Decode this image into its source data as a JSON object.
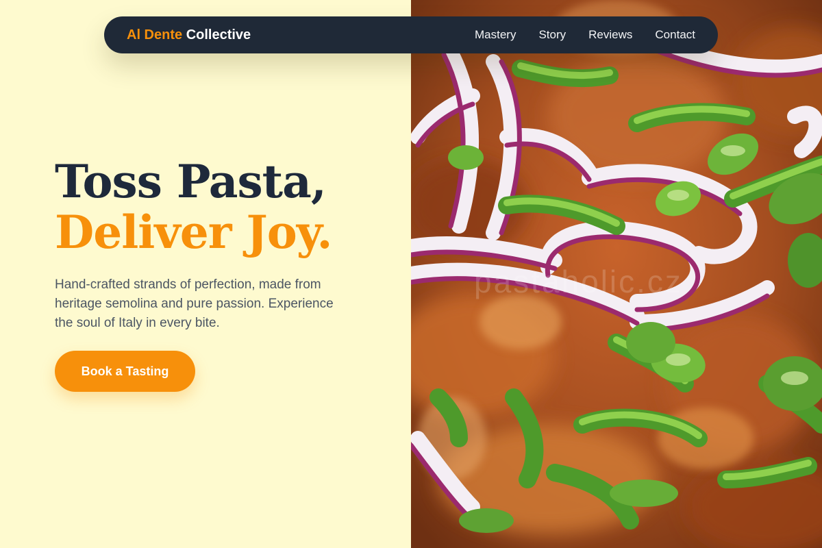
{
  "nav": {
    "brand_accent": "Al Dente",
    "brand_main": "Collective",
    "links": [
      "Mastery",
      "Story",
      "Reviews",
      "Contact"
    ]
  },
  "hero": {
    "headline_line1": "Toss Pasta,",
    "headline_line2": "Deliver Joy.",
    "subtext": "Hand-crafted strands of perfection, made from heritage semolina and pure passion. Experience the soul of Italy in every bite.",
    "cta_label": "Book a Tasting"
  },
  "photo": {
    "subject": "close-up of pasta topped with sliced red onion and green onion",
    "watermark": "pastaholic.cz"
  },
  "colors": {
    "background": "#fefacf",
    "accent": "#f7900b",
    "nav_background": "#1f2937",
    "headline_dark": "#1e293b",
    "body_text": "#4b5563"
  }
}
